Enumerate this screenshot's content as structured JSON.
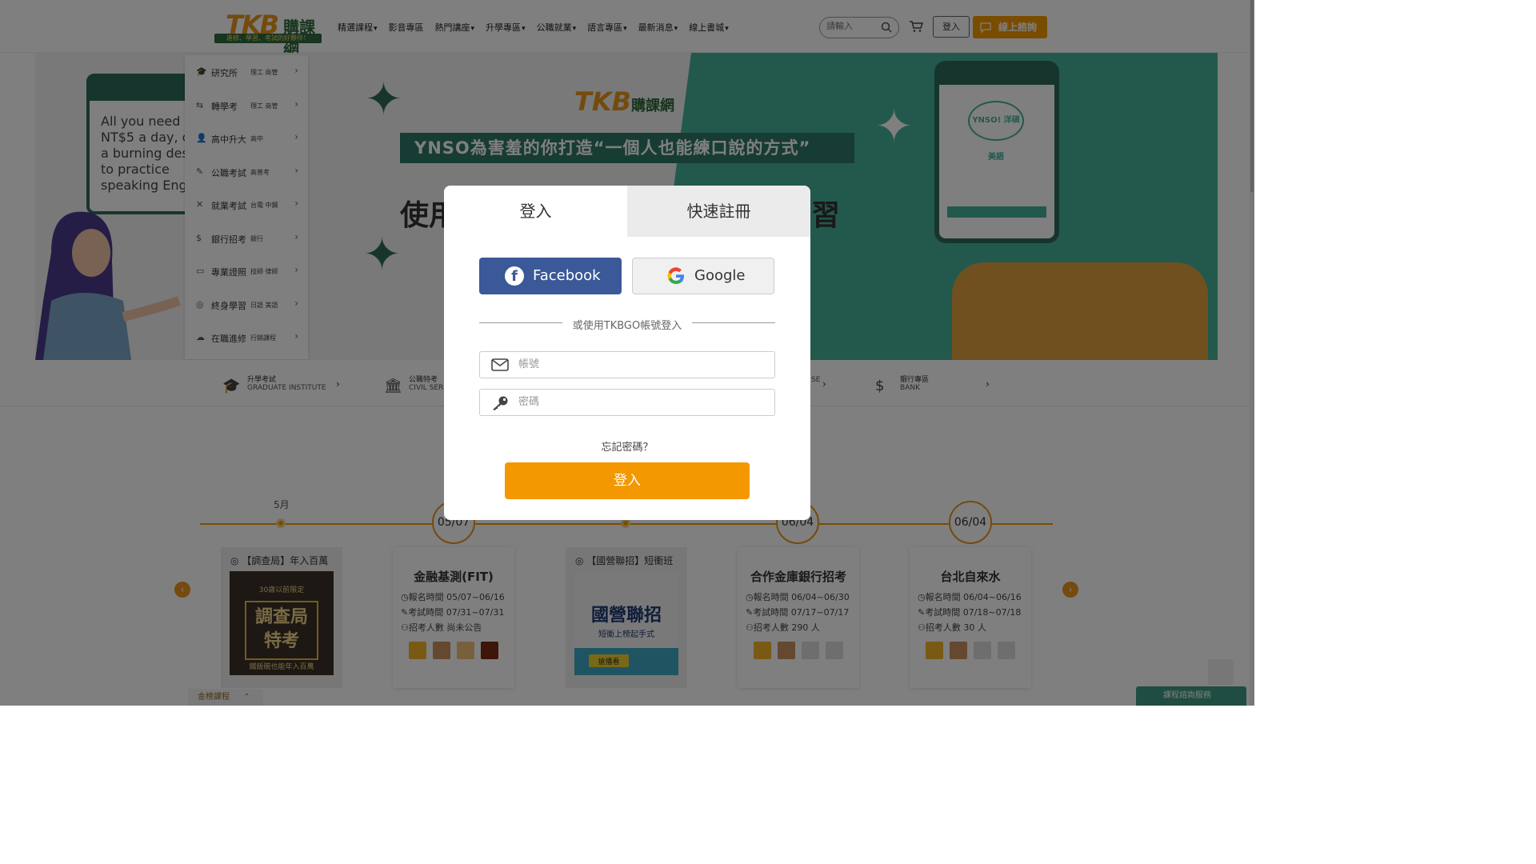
{
  "header": {
    "logo_main": "TKB",
    "logo_cn": "購課網",
    "logo_tagline": "進修、學習、考試的好夥伴！",
    "nav": [
      {
        "label": "精選課程",
        "dropdown": true
      },
      {
        "label": "影音專區",
        "dropdown": false
      },
      {
        "label": "熱門講座",
        "dropdown": true
      },
      {
        "label": "升學專區",
        "dropdown": true
      },
      {
        "label": "公職就業",
        "dropdown": true
      },
      {
        "label": "語言專區",
        "dropdown": true
      },
      {
        "label": "最新消息",
        "dropdown": true
      },
      {
        "label": "線上書城",
        "dropdown": true
      }
    ],
    "search_placeholder": "請輸入",
    "login_label": "登入",
    "consult_label": "線上諮詢"
  },
  "banner": {
    "bubble_text": "All you need\nNT$5 a day, c\na burning des\nto practice\nspeaking Eng",
    "logo_main": "TKB",
    "logo_cn": "購課網",
    "stripe_text": "YNSO為害羞的你打造“一個人也能練口說的方式”",
    "head_left": "使用",
    "head_right": "練習",
    "phone_logo": "YNSO! 洋碩美語"
  },
  "category_menu": [
    {
      "icon": "graduation-cap-icon",
      "glyph": "🎓",
      "label": "研究所",
      "sub": "理工 商管"
    },
    {
      "icon": "transfer-icon",
      "glyph": "⇆",
      "label": "轉學考",
      "sub": "理工 商管"
    },
    {
      "icon": "student-icon",
      "glyph": "👤",
      "label": "高中升大",
      "sub": "高中"
    },
    {
      "icon": "pencil-icon",
      "glyph": "✎",
      "label": "公職考試",
      "sub": "高普考"
    },
    {
      "icon": "tools-icon",
      "glyph": "✕",
      "label": "就業考試",
      "sub": "台電 中鋼"
    },
    {
      "icon": "dollar-icon",
      "glyph": "$",
      "label": "銀行招考",
      "sub": "銀行"
    },
    {
      "icon": "id-card-icon",
      "glyph": "▭",
      "label": "專業證照",
      "sub": "技師 律師"
    },
    {
      "icon": "lifelong-icon",
      "glyph": "◎",
      "label": "終身學習",
      "sub": "日語 美語"
    },
    {
      "icon": "cloud-icon",
      "glyph": "☁",
      "label": "在職進修",
      "sub": "行銷課程"
    }
  ],
  "category_strip": [
    {
      "icon": "graduation-cap-icon",
      "glyph": "🎓",
      "cn": "升學考試",
      "en": "GRADUATE INSTITUTE"
    },
    {
      "icon": "bank-building-icon",
      "glyph": "🏛",
      "cn": "公職特考",
      "en": "CIVIL SER"
    },
    {
      "icon": "partial-item",
      "glyph": "",
      "cn": "",
      "en": "SE"
    },
    {
      "icon": "dollar-icon",
      "glyph": "$",
      "cn": "銀行專區",
      "en": "BANK"
    }
  ],
  "timeline": {
    "month_label": "5月",
    "dates": [
      "05/07",
      "06/04",
      "06/04"
    ],
    "cards": [
      {
        "title": "金融基測(FIT)",
        "reg": "報名時間 05/07~06/16",
        "exam": "考試時間 07/31~07/31",
        "count": "招考人數 尚未公告"
      },
      {
        "title": "合作金庫銀行招考",
        "reg": "報名時間 06/04~06/30",
        "exam": "考試時間 07/17~07/17",
        "count": "招考人數 290 人"
      },
      {
        "title": "台北自來水",
        "reg": "報名時間 06/04~06/16",
        "exam": "考試時間 07/18~07/18",
        "count": "招考人數 30 人"
      }
    ],
    "image_cards": [
      {
        "header": "【調查局】年入百萬",
        "pic_title": "調查局\n特考",
        "pic_top": "30歲以前限定",
        "pic_bottom": "鐵飯碗也能年入百萬"
      },
      {
        "header": "【國營聯招】短衝班",
        "pic_title": "國營聯招",
        "pic_sub": "短衝上榜起手式",
        "pic_btn": "搶播看"
      }
    ]
  },
  "modal": {
    "tab_login": "登入",
    "tab_register": "快速註冊",
    "facebook_label": "Facebook",
    "google_label": "Google",
    "divider_text": "或使用TKBGO帳號登入",
    "account_placeholder": "帳號",
    "password_placeholder": "密碼",
    "forgot_label": "忘記密碼？",
    "submit_label": "登入"
  },
  "footer": {
    "bottom_tab": "金榜課程",
    "chat_label": "課程諮詢服務"
  },
  "colors": {
    "accent_orange": "#f39800",
    "facebook_blue": "#3b5998",
    "brand_green": "#2e6a3e",
    "banner_teal": "#46b39b"
  }
}
